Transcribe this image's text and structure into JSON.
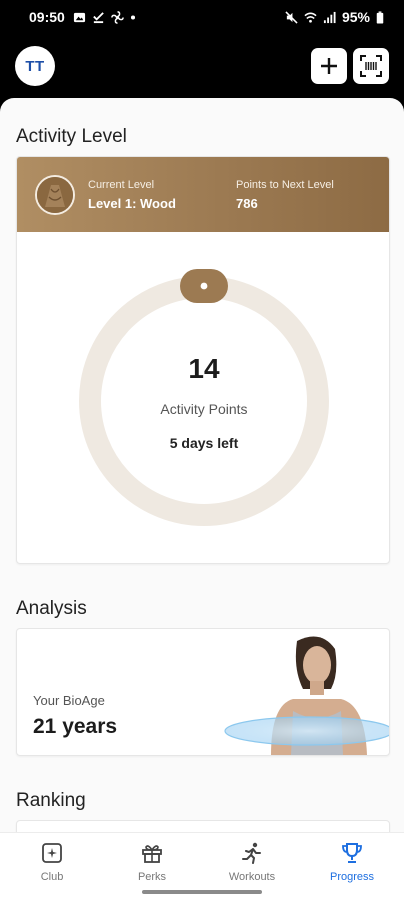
{
  "status_bar": {
    "time": "09:50",
    "battery": "95%",
    "icons": [
      "photo-icon",
      "check-download-icon",
      "fan-icon",
      "dot-icon",
      "mute-icon",
      "wifi-icon",
      "signal-icon",
      "battery-icon"
    ]
  },
  "header": {
    "avatar_initials": "TT",
    "add_icon": "plus-icon",
    "scan_icon": "scan-icon"
  },
  "activity": {
    "section_title": "Activity Level",
    "current_level_label": "Current Level",
    "current_level_value": "Level 1: Wood",
    "next_level_label": "Points to Next Level",
    "next_level_value": "786",
    "points_value": "14",
    "points_label": "Activity Points",
    "days_left": "5 days left",
    "ring_progress_fraction": 0.0,
    "colors": {
      "banner": "#9c7a52",
      "ring": "#efe9e1",
      "knob": "#9c7a52"
    }
  },
  "analysis": {
    "section_title": "Analysis",
    "bioage_label": "Your BioAge",
    "bioage_value": "21 years"
  },
  "ranking": {
    "section_title": "Ranking"
  },
  "bottom_nav": {
    "items": [
      {
        "label": "Club",
        "icon": "club-icon",
        "active": false
      },
      {
        "label": "Perks",
        "icon": "gift-icon",
        "active": false
      },
      {
        "label": "Workouts",
        "icon": "runner-icon",
        "active": false
      },
      {
        "label": "Progress",
        "icon": "trophy-icon",
        "active": true
      }
    ],
    "active_color": "#1e6fe0"
  }
}
